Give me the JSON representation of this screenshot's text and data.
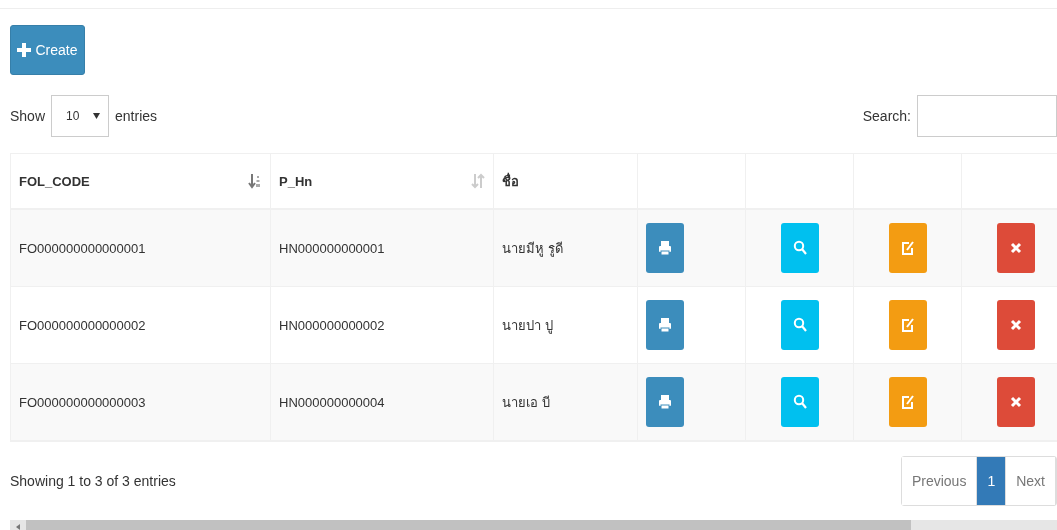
{
  "create_button": {
    "label": "Create"
  },
  "length_control": {
    "prefix": "Show",
    "value": "10",
    "suffix": "entries"
  },
  "search": {
    "label": "Search:"
  },
  "table": {
    "columns": [
      {
        "label": "FOL_CODE",
        "sorted": true
      },
      {
        "label": "P_Hn",
        "sorted": false
      },
      {
        "label": "ชื่อ"
      }
    ],
    "rows": [
      {
        "cells": [
          "FO000000000000001",
          "HN000000000001",
          "นายมีหู รูดี"
        ],
        "actions": [
          {
            "kind": "print"
          },
          {
            "kind": "view"
          },
          {
            "kind": "edit"
          },
          {
            "kind": "delete"
          }
        ]
      },
      {
        "cells": [
          "FO000000000000002",
          "HN000000000002",
          "นายปา ปู"
        ],
        "actions": [
          {
            "kind": "print"
          },
          {
            "kind": "view"
          },
          {
            "kind": "edit"
          },
          {
            "kind": "delete"
          }
        ]
      },
      {
        "cells": [
          "FO000000000000003",
          "HN000000000004",
          "นายเอ บี"
        ],
        "actions": [
          {
            "kind": "print"
          },
          {
            "kind": "view"
          },
          {
            "kind": "edit"
          },
          {
            "kind": "delete"
          }
        ]
      }
    ]
  },
  "info": "Showing 1 to 3 of 3 entries",
  "pagination": [
    {
      "label": "Previous",
      "selected": false
    },
    {
      "label": "1",
      "selected": true
    },
    {
      "label": "Next",
      "selected": false
    }
  ]
}
